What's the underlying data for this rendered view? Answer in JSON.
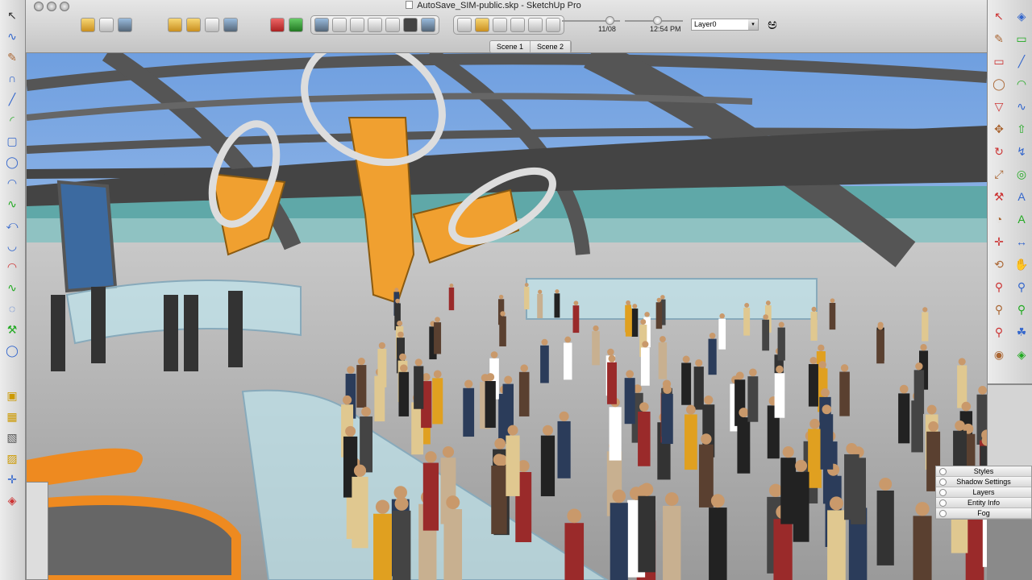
{
  "window": {
    "title": "AutoSave_SIM-public.skp - SketchUp Pro"
  },
  "toolbar": {
    "shadow_date": "11/08",
    "shadow_time": "12:54 PM",
    "layer": "Layer0"
  },
  "scenes": [
    {
      "label": "Scene 1"
    },
    {
      "label": "Scene 2"
    }
  ],
  "trays": [
    {
      "label": "Styles"
    },
    {
      "label": "Shadow Settings"
    },
    {
      "label": "Layers"
    },
    {
      "label": "Entity Info"
    },
    {
      "label": "Fog"
    }
  ],
  "left_tools": [
    "select",
    "freehand",
    "paint",
    "arc",
    "line",
    "arc-2",
    "rectangle",
    "circle",
    "arc-3",
    "freehand-2",
    "arc-4",
    "arc-5",
    "arc-6",
    "freehand-3",
    "offset",
    "tape-measure",
    "circle-2",
    "push-pull",
    "cube",
    "cube-2",
    "cube-3",
    "axes",
    "section"
  ],
  "right_tools": [
    "select",
    "component",
    "paint",
    "eraser",
    "rectangle",
    "line",
    "circle",
    "arc",
    "polygon",
    "freehand",
    "move",
    "push-pull",
    "rotate",
    "follow-me",
    "scale",
    "offset",
    "tape-measure",
    "text",
    "protractor",
    "3d-text",
    "axes",
    "dimension",
    "orbit",
    "pan",
    "zoom",
    "zoom-window",
    "zoom-extents",
    "previous",
    "position-camera",
    "walk",
    "look-around",
    "section-plane"
  ],
  "colors": {
    "sky": "#8fb6e6",
    "teal": "#5fa8a8",
    "floor": "#b8b8b8",
    "orange": "#f0a030"
  }
}
